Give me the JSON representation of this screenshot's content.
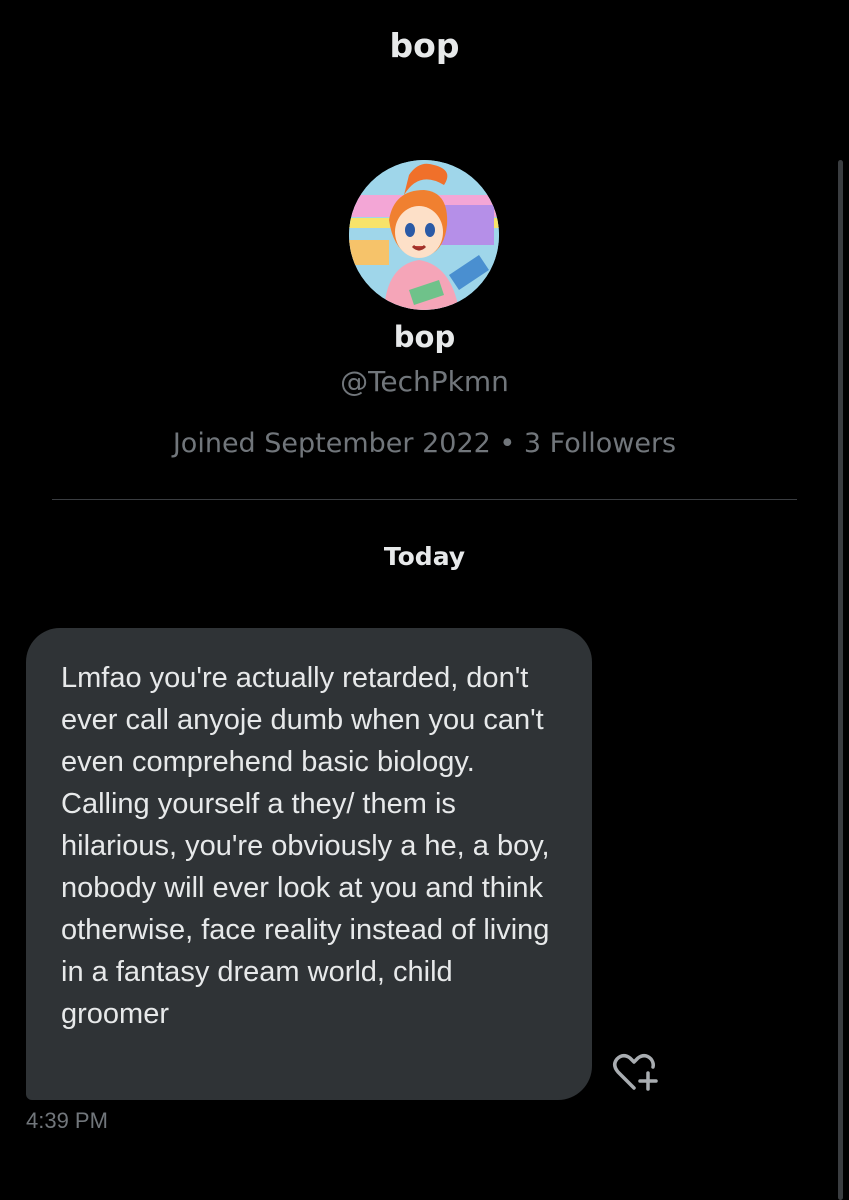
{
  "header": {
    "title": "bop"
  },
  "profile": {
    "name": "bop",
    "handle": "@TechPkmn",
    "meta": "Joined September 2022 • 3 Followers"
  },
  "conversation": {
    "date_label": "Today",
    "messages": [
      {
        "text": "Lmfao you're actually retarded, don't ever call anyoje dumb when you can't even comprehend basic biology. Calling yourself a they/ them is hilarious, you're obviously a he, a boy, nobody will ever look at you and think otherwise, face reality instead of living in a fantasy dream world, child groomer",
        "time": "4:39 PM"
      }
    ]
  },
  "icons": {
    "react": "heart-plus-icon"
  },
  "colors": {
    "background": "#000000",
    "bubble": "#2f3336",
    "primary_text": "#e7e9ea",
    "secondary_text": "#71767b"
  }
}
